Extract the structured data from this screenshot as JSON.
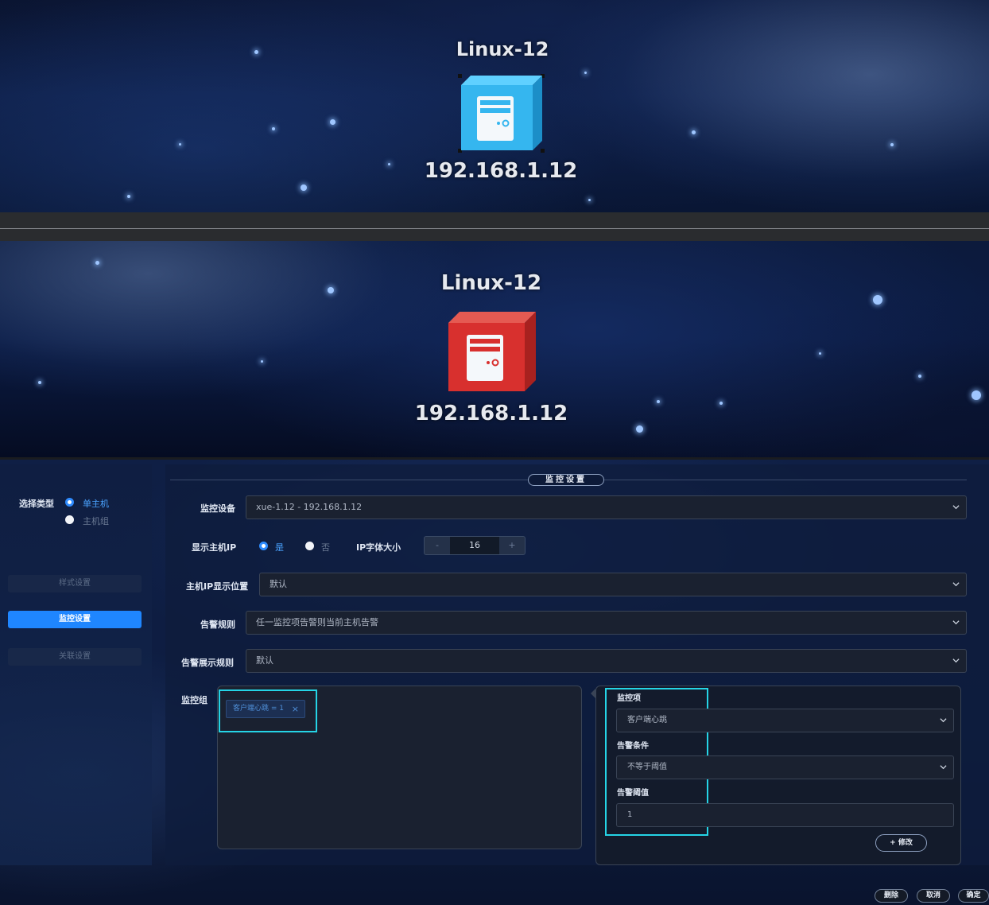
{
  "preview_normal": {
    "node_name": "Linux-12",
    "node_ip": "192.168.1.12",
    "icon": "server-icon",
    "color": "#35b6ef"
  },
  "preview_alarm": {
    "node_name": "Linux-12",
    "node_ip": "192.168.1.12",
    "icon": "server-icon",
    "color": "#d8302e"
  },
  "sidebar": {
    "select_type_label": "选择类型",
    "options": [
      {
        "label": "单主机",
        "selected": true
      },
      {
        "label": "主机组",
        "selected": false
      }
    ],
    "tabs": [
      {
        "label": "样式设置",
        "active": false
      },
      {
        "label": "监控设置",
        "active": true
      },
      {
        "label": "关联设置",
        "active": false
      }
    ]
  },
  "section_title": "监控设置",
  "form": {
    "device_label": "监控设备",
    "device_value": "xue-1.12 - 192.168.1.12",
    "show_ip_label": "显示主机IP",
    "show_ip_yes": "是",
    "show_ip_no": "否",
    "ip_font_size_label": "IP字体大小",
    "ip_font_size_minus": "-",
    "ip_font_size_value": "16",
    "ip_font_size_plus": "+",
    "ip_position_label": "主机IP显示位置",
    "ip_position_value": "默认",
    "alarm_rule_label": "告警规则",
    "alarm_rule_value": "任一监控项告警则当前主机告警",
    "alarm_display_label": "告警展示规则",
    "alarm_display_value": "默认",
    "group_label": "监控组",
    "group_tags": [
      {
        "label": "客户端心跳 = 1",
        "close": "×"
      }
    ]
  },
  "monitor_item": {
    "item_label": "监控项",
    "item_value": "客户端心跳",
    "condition_label": "告警条件",
    "condition_value": "不等于阈值",
    "threshold_label": "告警阈值",
    "threshold_value": "1",
    "modify_button": "+ 修改"
  },
  "footer": {
    "delete": "删除",
    "cancel": "取消",
    "confirm": "确定"
  },
  "colors": {
    "accent": "#1f86ff",
    "highlight": "#25d4e6"
  }
}
